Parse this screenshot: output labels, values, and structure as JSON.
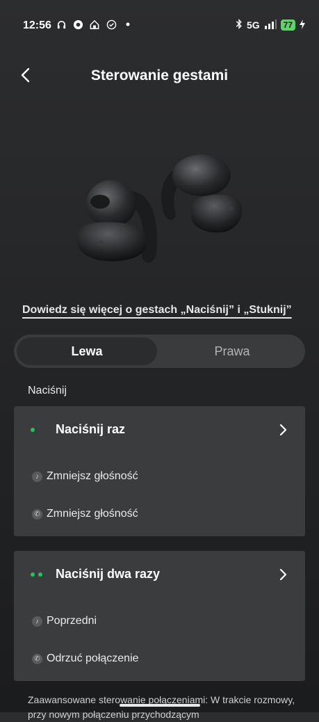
{
  "status_bar": {
    "time": "12:56",
    "left_icons": [
      "headphones-icon",
      "circle-app-icon",
      "home-app-icon",
      "check-icon",
      "dot-icon"
    ],
    "network": "5G",
    "battery": "77"
  },
  "header": {
    "title": "Sterowanie gestami",
    "back_icon": "chevron-left-icon"
  },
  "learn_more": "Dowiedz się więcej o gestach „Naciśnij” i „Stuknij”",
  "tabs": {
    "left": "Lewa",
    "right": "Prawa",
    "selected": "Lewa"
  },
  "section": {
    "label": "Naciśnij"
  },
  "cards": [
    {
      "title": "Naciśnij raz",
      "dots": 1,
      "rows": [
        {
          "icon": "music-note-icon",
          "label": "Zmniejsz głośność"
        },
        {
          "icon": "phone-icon",
          "label": "Zmniejsz głośność"
        }
      ]
    },
    {
      "title": "Naciśnij dwa razy",
      "dots": 2,
      "rows": [
        {
          "icon": "music-note-icon",
          "label": "Poprzedni"
        },
        {
          "icon": "phone-icon",
          "label": "Odrzuć połączenie"
        }
      ]
    }
  ],
  "footnote": "Zaawansowane sterowanie połączeniami: W trakcie rozmowy, przy nowym połączeniu przychodzącym",
  "colors": {
    "accent_green": "#1ec55a",
    "battery_green": "#5fd36a",
    "card_bg": "#3b3c3e"
  }
}
